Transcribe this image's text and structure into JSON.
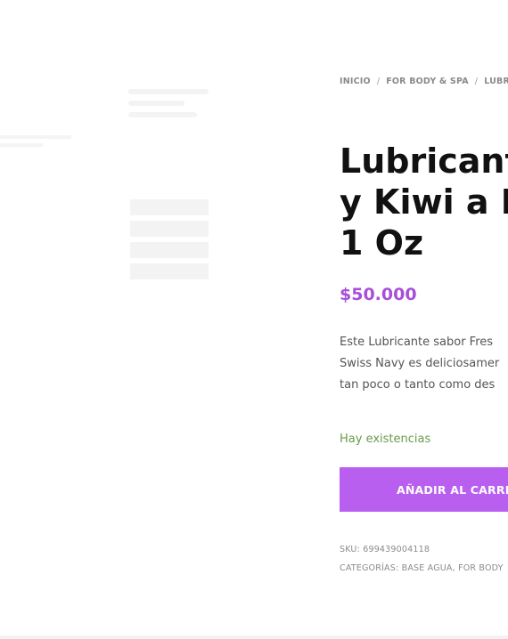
{
  "breadcrumb": {
    "items": [
      "INICIO",
      "FOR BODY & SPA",
      "LUBRIC"
    ],
    "separator": "/"
  },
  "product": {
    "title_lines": [
      "Lubricant",
      "y Kiwi a B",
      "1 Oz"
    ],
    "price": "$50.000",
    "description_lines": [
      "Este Lubricante sabor Fres",
      "Swiss Navy es deliciosamer",
      "tan poco o tanto como des"
    ],
    "stock": "Hay existencias",
    "add_to_cart_label": "AÑADIR AL CARRIT"
  },
  "meta": {
    "sku_label": "SKU:",
    "sku_value": "699439004118",
    "categories_label": "CATEGORÍAS:",
    "categories_value": "BASE AGUA, FOR BODY"
  },
  "colors": {
    "accent": "#b95ff0",
    "price": "#a84fd8",
    "stock": "#6b9a4d"
  }
}
